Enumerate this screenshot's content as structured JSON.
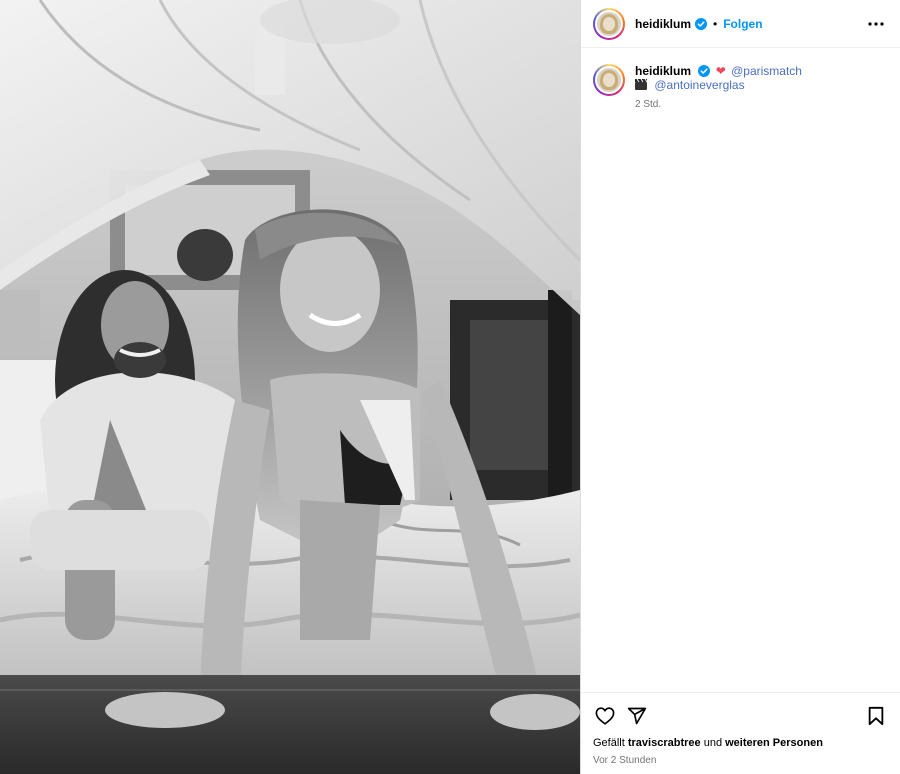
{
  "post": {
    "author": {
      "username": "heidiklum",
      "verified": true,
      "follow_label": "Folgen",
      "separator": "•"
    },
    "more_icon": "more-horizontal-icon",
    "caption": {
      "username": "heidiklum",
      "emoji_heart": "❤",
      "mention_1": "@parismatch",
      "emoji_camera": "clapper-board-icon",
      "mention_2": "@antoineverglas",
      "time": "2 Std."
    },
    "actions": {
      "like_icon": "heart-icon",
      "share_icon": "send-icon",
      "save_icon": "bookmark-icon"
    },
    "likes": {
      "prefix": "Gefällt",
      "user": "traviscrabtree",
      "conjunction": "und",
      "others": "weiteren Personen"
    },
    "posted_ago": "Vor 2 Stunden",
    "colors": {
      "follow_blue": "#0095f6",
      "verified_blue": "#0095f6",
      "mention": "#4b6fbf",
      "heart_red": "#ed4956",
      "muted": "#737373"
    },
    "photo": {
      "description_icon": "photo-image"
    }
  }
}
